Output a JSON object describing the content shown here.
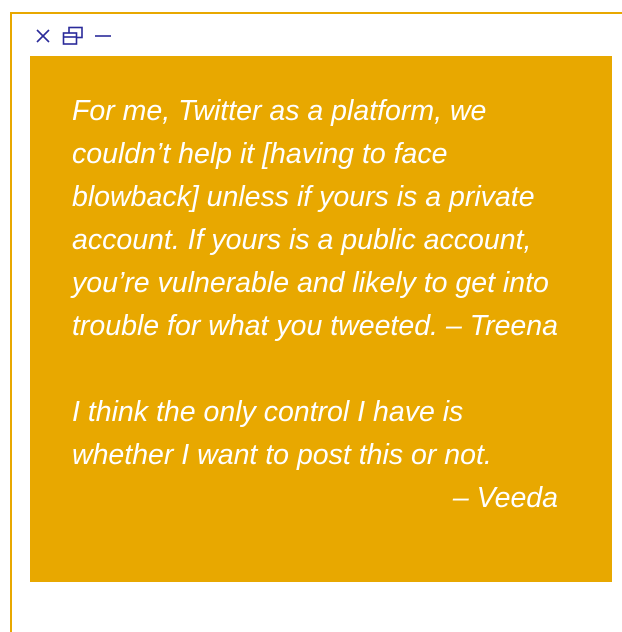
{
  "window_controls": {
    "close_icon": "close-icon",
    "restore_icon": "restore-icon",
    "minimize_icon": "minimize-icon"
  },
  "colors": {
    "accent": "#e8a800",
    "text": "#ffffff"
  },
  "quotes": [
    {
      "text": "For me, Twitter as a platform, we couldn’t help it [having to face blowback] unless if yours is a private account. If yours is a public account, you’re vulnerable and likely to get into trouble for what you tweeted.",
      "attribution": "– Treena"
    },
    {
      "text": "I think the only control I have is whether I want to post this or not.",
      "attribution": "– Veeda"
    }
  ]
}
